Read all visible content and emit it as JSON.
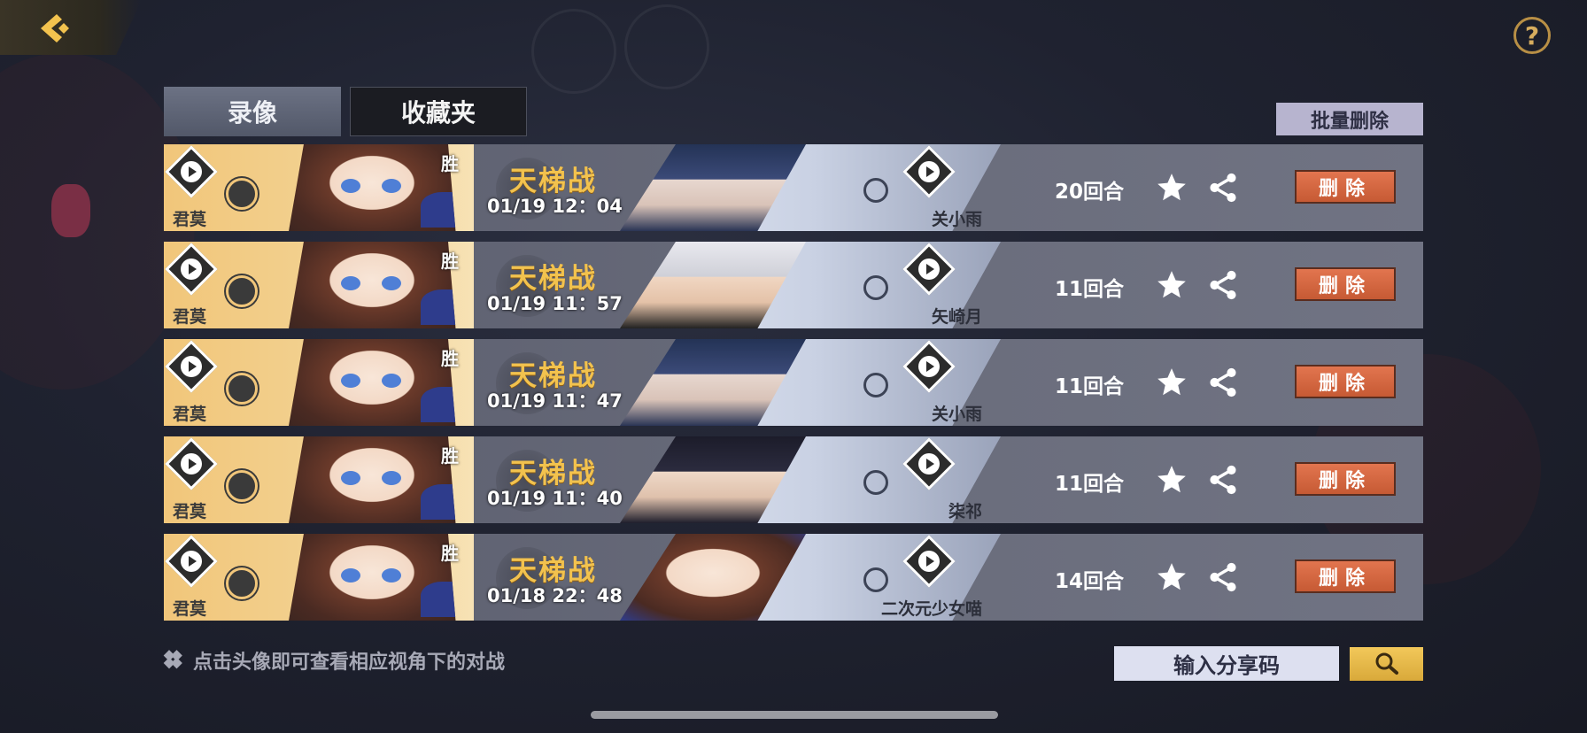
{
  "header": {
    "back_icon": "back-arrow-icon",
    "help_icon": "question-mark-icon",
    "help_symbol": "?"
  },
  "tabs": [
    {
      "label": "录像",
      "active": true
    },
    {
      "label": "收藏夹",
      "active": false
    }
  ],
  "batch_delete_label": "批量删除",
  "records": [
    {
      "player": "君莫",
      "result": "胜",
      "mode": "天梯战",
      "time": "01/19 12：04",
      "opponent": "关小雨",
      "rounds": "20回合",
      "delete_label": "删除"
    },
    {
      "player": "君莫",
      "result": "胜",
      "mode": "天梯战",
      "time": "01/19 11：57",
      "opponent": "矢崎月",
      "rounds": "11回合",
      "delete_label": "删除"
    },
    {
      "player": "君莫",
      "result": "胜",
      "mode": "天梯战",
      "time": "01/19 11：47",
      "opponent": "关小雨",
      "rounds": "11回合",
      "delete_label": "删除"
    },
    {
      "player": "君莫",
      "result": "胜",
      "mode": "天梯战",
      "time": "01/19 11：40",
      "opponent": "柒祁",
      "rounds": "11回合",
      "delete_label": "删除"
    },
    {
      "player": "君莫",
      "result": "胜",
      "mode": "天梯战",
      "time": "01/18 22：48",
      "opponent": "二次元少女喵",
      "rounds": "14回合",
      "delete_label": "删除"
    }
  ],
  "tip": "点击头像即可查看相应视角下的对战",
  "share_code_label": "输入分享码",
  "colors": {
    "accent_gold": "#f2c24e",
    "delete_red": "#d2643d",
    "tab_active": "#5f6577"
  }
}
